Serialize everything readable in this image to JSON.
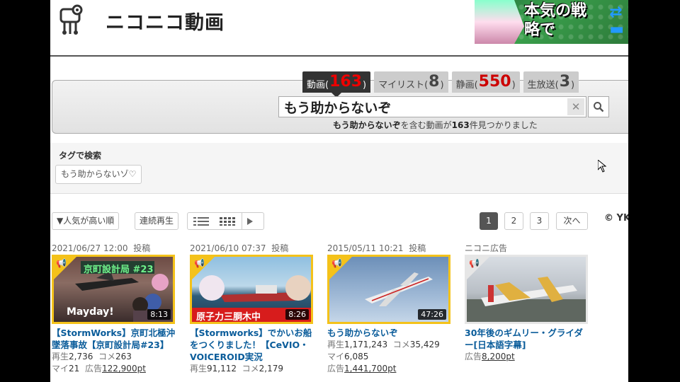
{
  "header": {
    "logo_text": "ニコニコ動画",
    "banner_text": "本気の戦略で"
  },
  "search": {
    "tabs": [
      {
        "prefix": "動画(",
        "count": "163",
        "suffix": ")"
      },
      {
        "prefix": "マイリスト(",
        "count": "8",
        "suffix": ")"
      },
      {
        "prefix": "静画(",
        "count": "550",
        "suffix": ")"
      },
      {
        "prefix": "生放送(",
        "count": "3",
        "suffix": ")"
      }
    ],
    "query": "もう助からないぞ",
    "clear_label": "✕",
    "result_query": "もう助からないぞ",
    "result_mid": "を含む動画が",
    "result_count": "163",
    "result_end": "件見つかりました"
  },
  "tags": {
    "title": "タグで検索",
    "chip": "もう助からないゾ♡"
  },
  "toolbar": {
    "sort_label": "▼人気が高い順",
    "continuous_label": "連続再生",
    "pages": [
      "1",
      "2",
      "3"
    ],
    "next_label": "次へ",
    "copyright": "© YK"
  },
  "videos": [
    {
      "date": "2021/06/27 12:00",
      "posted": "投稿",
      "duration": "8:13",
      "thumb_caption": "京町設計局  #23",
      "thumb_sub": "Mayday!",
      "title": "【StormWorks】京町北極沖墜落事故【京町設計局#23】",
      "views_label": "再生",
      "views": "2,736",
      "comments_label": "コメ",
      "comments": "263",
      "mylist_label": "マイ",
      "mylist": "21",
      "ad_label": "広告",
      "ad": "122,900pt"
    },
    {
      "date": "2021/06/10 07:37",
      "posted": "投稿",
      "duration": "8:26",
      "thumb_caption": "原子力三胴木中",
      "title": "【Stormworks】でかいお船をつくりました！【CeVIO・VOICEROID実況",
      "views_label": "再生",
      "views": "91,112",
      "comments_label": "コメ",
      "comments": "2,179"
    },
    {
      "date": "2015/05/11 10:21",
      "posted": "投稿",
      "duration": "47:26",
      "title": "もう助からないぞ",
      "views_label": "再生",
      "views": "1,171,243",
      "comments_label": "コメ",
      "comments": "35,429",
      "mylist_label": "マイ",
      "mylist": "6,085",
      "ad_label": "広告",
      "ad": "1,441,700pt"
    },
    {
      "date": "ニコニ広告",
      "title": "30年後のギムリー・グライダー[日本語字幕]",
      "ad_label": "広告",
      "ad": "8,200pt"
    }
  ],
  "colors": {
    "count_red": "#cc0000",
    "title_blue": "#0a5c9a",
    "thumb_border": "#f4c21a"
  }
}
